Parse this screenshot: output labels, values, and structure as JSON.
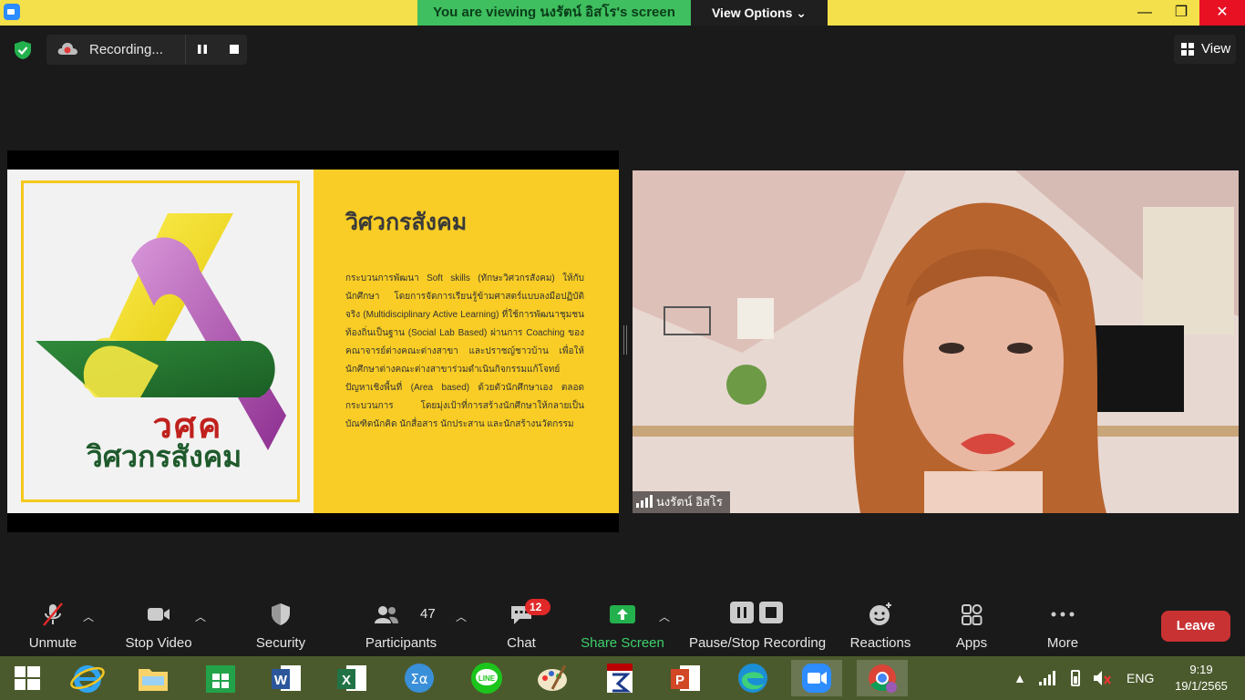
{
  "window": {
    "banner_text": "You  are  viewing นงรัตน์ อิสโร's screen",
    "view_options_label": "View Options",
    "minimize": "—",
    "maximize": "❐",
    "close": "✕"
  },
  "recording": {
    "label": "Recording...",
    "view_label": "View"
  },
  "slide": {
    "logo_abbr": "วศค",
    "logo_name": "วิศวกรสังคม",
    "title": "วิศวกรสังคม",
    "body": "กระบวนการพัฒนา Soft skills (ทักษะวิศวกรสังคม) ให้กับนักศึกษา โดยการจัดการเรียนรู้ข้ามศาสตร์แบบลงมือปฏิบัติจริง (Multidisciplinary Active Learning) ที่ใช้การพัฒนาชุมชนท้องถิ่นเป็นฐาน (Social Lab Based) ผ่านการ Coaching ของคณาจารย์ต่างคณะต่างสาขา และปราชญ์ชาวบ้าน เพื่อให้นักศึกษาต่างคณะต่างสาขาร่วมดำเนินกิจกรรมแก้โจทย์ปัญหาเชิงพื้นที่ (Area based) ด้วยตัวนักศึกษาเอง ตลอดกระบวนการ โดยมุ่งเป้าที่การสร้างนักศึกษาให้กลายเป็นบัณฑิตนักคิด นักสื่อสาร นักประสาน และนักสร้างนวัตกรรม"
  },
  "video": {
    "participant_name": "นงรัตน์ อิสโร"
  },
  "toolbar": {
    "unmute": "Unmute",
    "stop_video": "Stop Video",
    "security": "Security",
    "participants": "Participants",
    "participants_count": "47",
    "chat": "Chat",
    "chat_badge": "12",
    "share_screen": "Share Screen",
    "pause_stop_recording": "Pause/Stop Recording",
    "reactions": "Reactions",
    "apps": "Apps",
    "more": "More",
    "leave": "Leave"
  },
  "taskbar": {
    "language": "ENG",
    "time": "9:19",
    "date": "19/1/2565",
    "apps": [
      "windows-start",
      "internet-explorer",
      "file-explorer",
      "store",
      "word",
      "excel",
      "calculator",
      "line",
      "paint",
      "lisrel",
      "powerpoint",
      "edge",
      "zoom",
      "chrome"
    ]
  },
  "colors": {
    "banner_green": "#3fbf5f",
    "title_yellow": "#f4e04a",
    "slide_yellow": "#f9cd25",
    "leave_red": "#c93232",
    "share_green": "#3dd16b",
    "taskbar": "#4b5a2c"
  }
}
